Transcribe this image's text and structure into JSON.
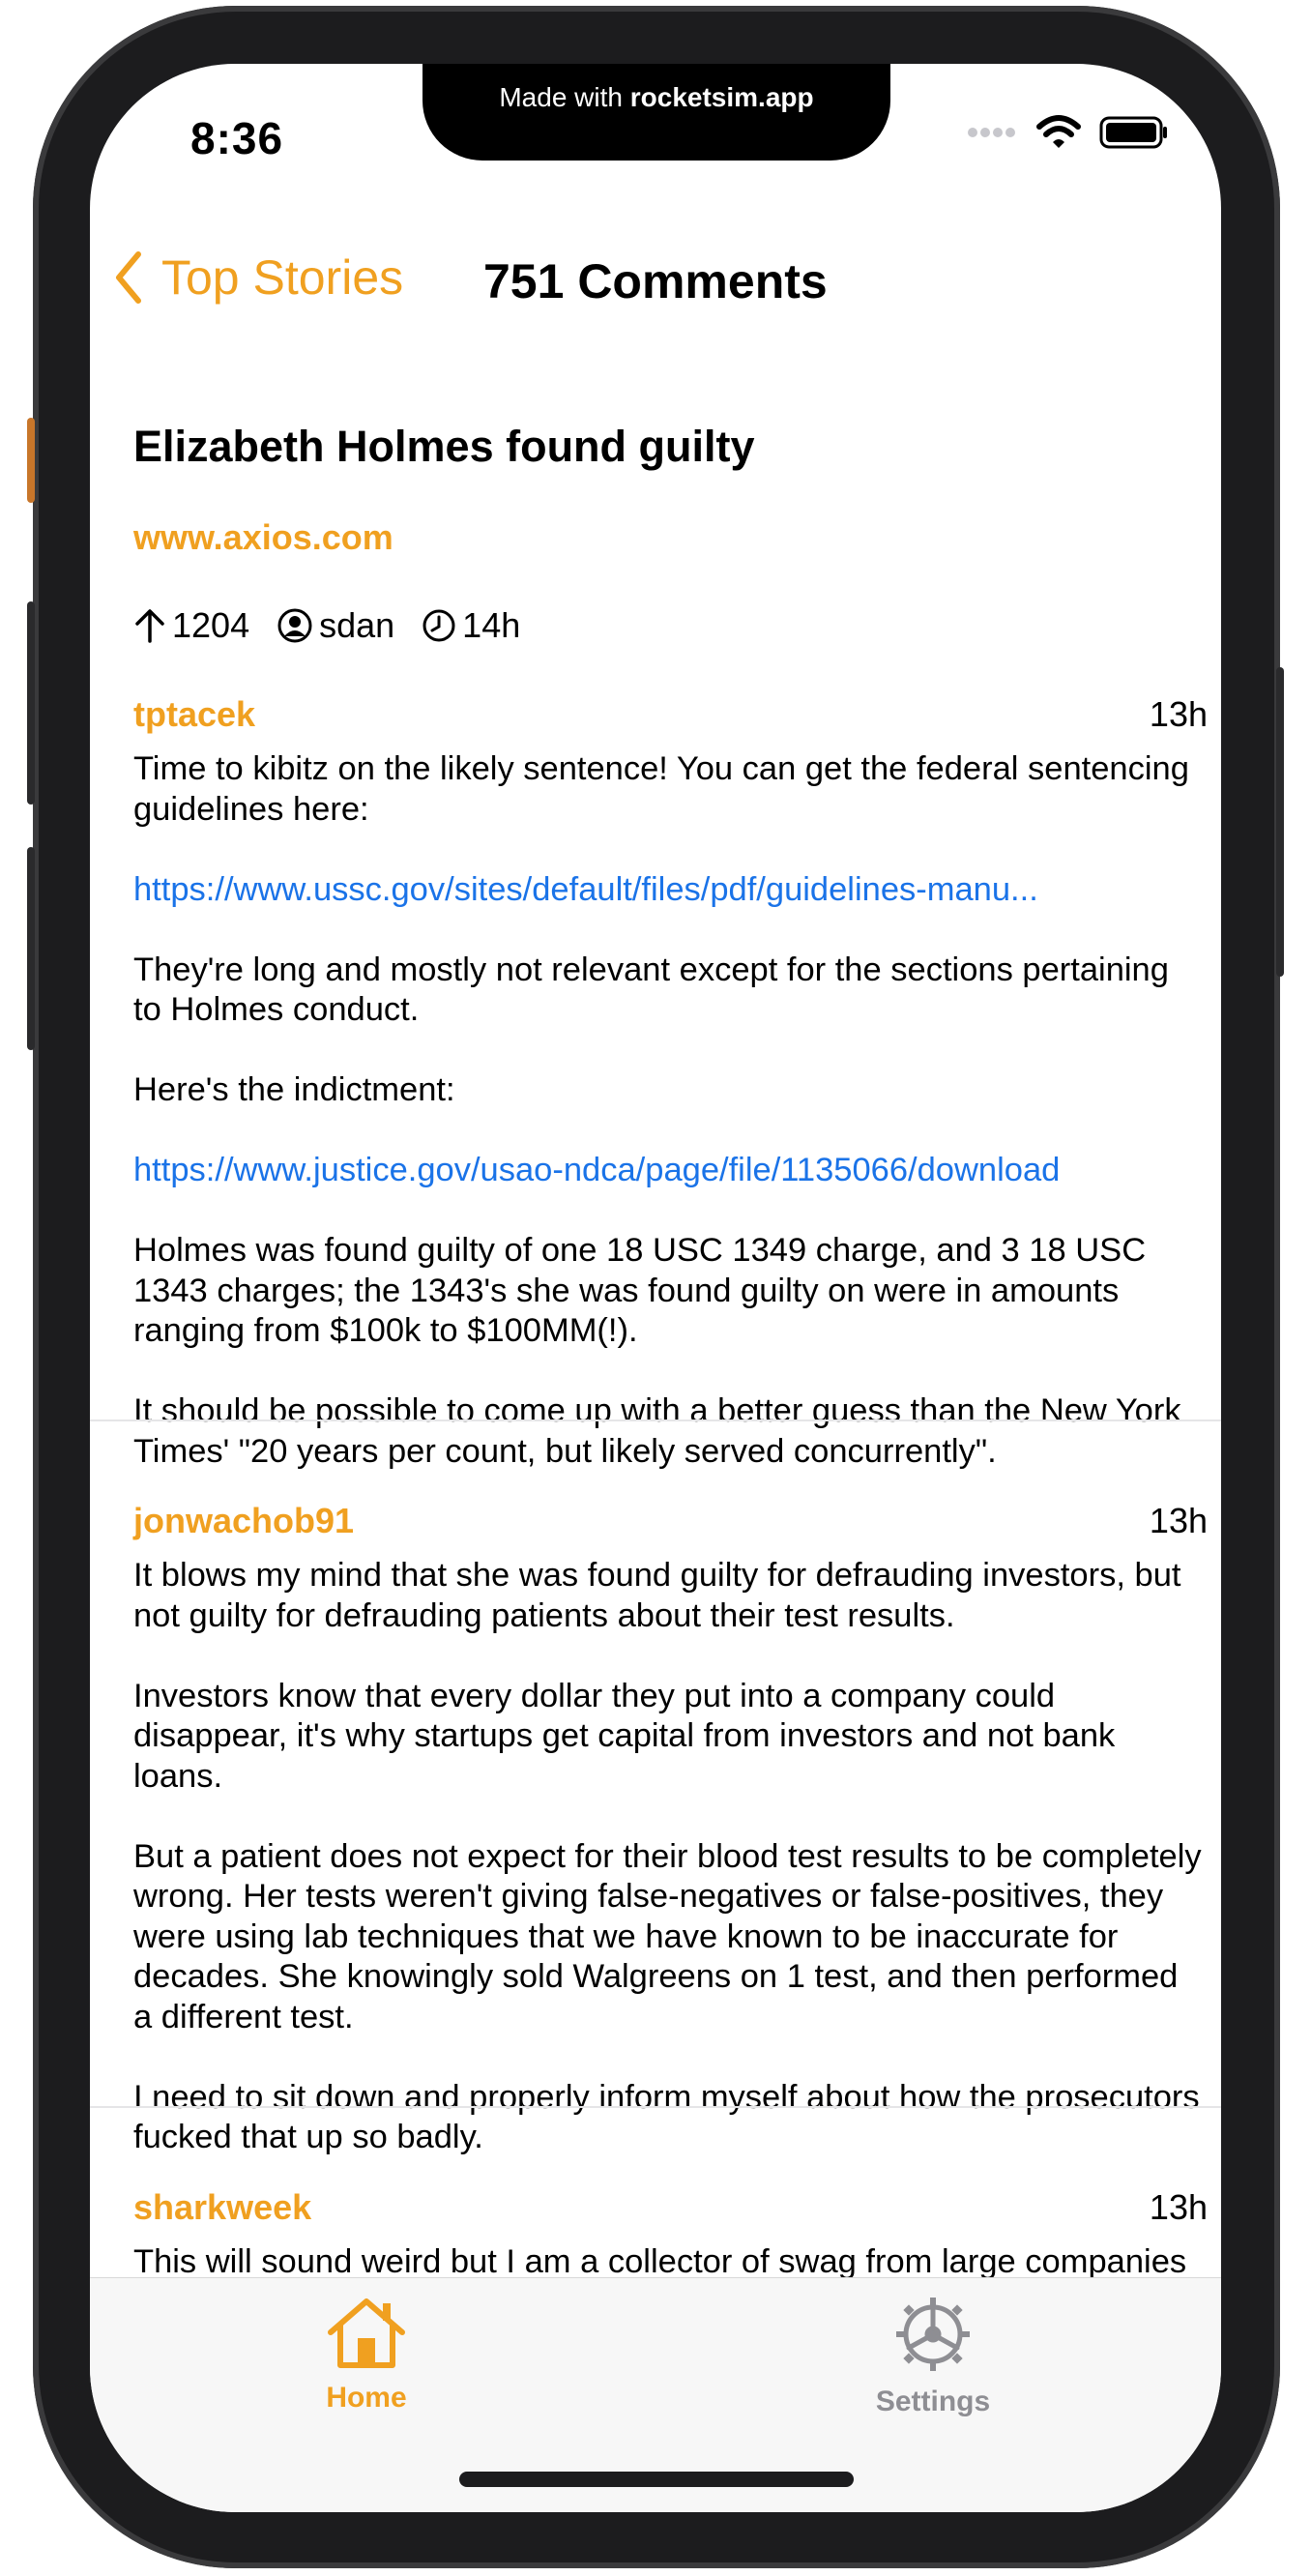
{
  "simulator_banner": {
    "prefix": "Made with ",
    "brand": "rocketsim.app"
  },
  "status_bar": {
    "time": "8:36"
  },
  "nav": {
    "back_label": "Top Stories",
    "title": "751 Comments"
  },
  "story": {
    "title": "Elizabeth Holmes found guilty",
    "url": "www.axios.com",
    "points": "1204",
    "author": "sdan",
    "age": "14h"
  },
  "comments": [
    {
      "author": "tptacek",
      "time": "13h",
      "paragraphs": [
        "Time to kibitz on the likely sentence! You can get the federal sentencing guidelines here:",
        "https://www.ussc.gov/sites/default/files/pdf/guidelines-manu...",
        "They're long and mostly not relevant except for the sections pertaining to Holmes conduct.",
        "Here's the indictment:",
        "https://www.justice.gov/usao-ndca/page/file/1135066/download",
        "Holmes was found guilty of one 18 USC 1349 charge, and 3 18 USC 1343 charges; the 1343's she was found guilty on were in amounts ranging from $100k to $100MM(!).",
        "It should be possible to come up with a better guess than the New York Times' \"20 years per count, but likely served concurrently\"."
      ]
    },
    {
      "author": "jonwachob91",
      "time": "13h",
      "paragraphs": [
        "It blows my mind that she was found guilty for defrauding investors, but not guilty for defrauding patients about their test results.",
        "Investors know that every dollar they put into a company could disappear, it's why startups get capital from investors and not bank loans.",
        "But a patient does not expect for their blood test results to be completely wrong. Her tests weren't giving false-negatives or false-positives, they were using lab techniques that we have known to be inaccurate for decades. She knowingly sold Walgreens on 1 test, and then performed a different test.",
        "I need to sit down and properly inform myself about how the prosecutors fucked that up so badly."
      ]
    },
    {
      "author": "sharkweek",
      "time": "13h",
      "paragraphs": [
        "This will sound weird but I am a collector of swag from large companies that have collapsed due to anything from mismanagement to outright fraud. While modern swag doesn't carry as the quality..."
      ]
    }
  ],
  "tabbar": {
    "home_label": "Home",
    "settings_label": "Settings"
  },
  "colors": {
    "accent": "#f0a020",
    "link": "#1a73e8",
    "tab_inactive": "#8e8e93"
  }
}
